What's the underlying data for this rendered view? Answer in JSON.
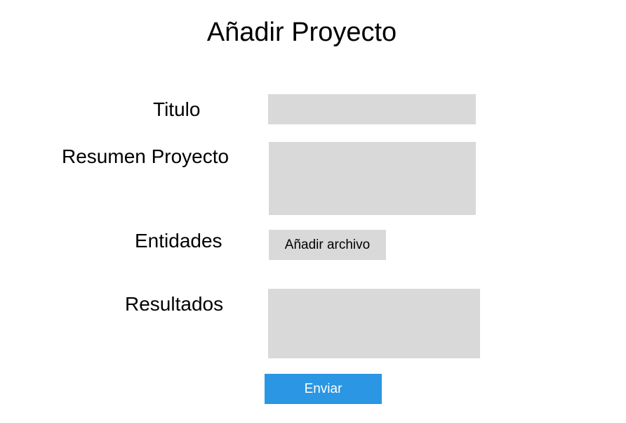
{
  "page": {
    "title": "Añadir Proyecto"
  },
  "form": {
    "titulo_label": "Titulo",
    "titulo_value": "",
    "resumen_label": "Resumen Proyecto",
    "resumen_value": "",
    "entidades_label": "Entidades",
    "entidades_button": "Añadir archivo",
    "resultados_label": "Resultados",
    "resultados_value": "",
    "submit_label": "Enviar"
  },
  "colors": {
    "field_background": "#d9d9d9",
    "submit_background": "#2b96e3",
    "submit_text": "#ffffff"
  }
}
